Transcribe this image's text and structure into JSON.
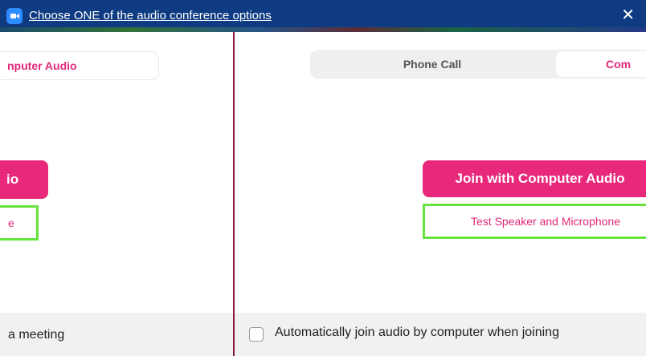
{
  "window": {
    "title": "Choose ONE of the audio conference options",
    "close_glyph": "✕",
    "title_bar_color": "#0e3b82",
    "app_icon": "zoom-camera-icon"
  },
  "left_pane": {
    "tab_label": "nputer Audio",
    "join_label": "io",
    "test_label": "e",
    "footer_text": "a meeting"
  },
  "right_pane": {
    "tabs": [
      {
        "label": "Phone Call",
        "selected": false
      },
      {
        "label": "Com",
        "selected": true
      }
    ],
    "join_button_label": "Join with Computer Audio",
    "test_link_label": "Test Speaker and Microphone",
    "auto_join_label": "Automatically join audio by computer when joining",
    "auto_join_checked": false
  },
  "colors": {
    "accent": "#e8287a",
    "highlight_border": "#66e33c",
    "footer_bg": "#f1f1f1",
    "divider": "#8a1f3b"
  }
}
